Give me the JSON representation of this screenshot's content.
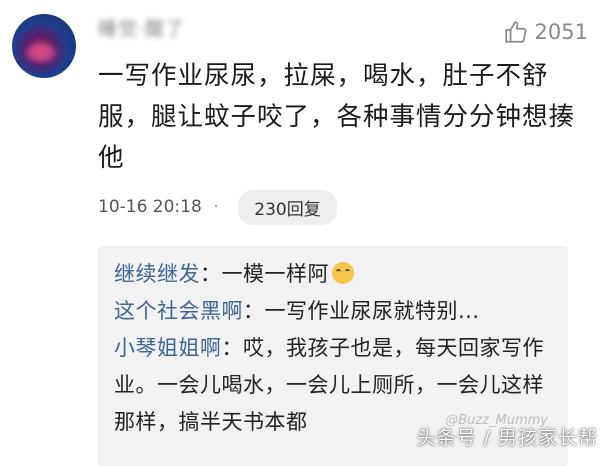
{
  "comment": {
    "username": "睡觉·醒了",
    "likes": "2051",
    "text": "一写作业尿尿，拉屎，喝水，肚子不舒服，腿让蚊子咬了，各种事情分分钟想揍他",
    "time": "10-16 20:18",
    "dot": "·",
    "reply_count": "230回复"
  },
  "replies": [
    {
      "name": "继续继发",
      "sep": "：",
      "text": "一模一样阿",
      "emoji": "crying-face"
    },
    {
      "name": "这个社会黑啊",
      "sep": "：",
      "text": "一写作业尿尿就特别..."
    },
    {
      "name": "小琴姐姐啊",
      "sep": "：",
      "text": "哎，我孩子也是，每天回家写作业。一会儿喝水，一会儿上厕所，一会儿这样那样，搞半天书本都"
    }
  ],
  "watermark": {
    "main": "头条号 / 男孩家长帮",
    "faint": "@Buzz_Mummy"
  },
  "colors": {
    "reply_name": "#3d6698",
    "reply_bg": "#f2f2f2",
    "pill_bg": "#eeeeee"
  }
}
